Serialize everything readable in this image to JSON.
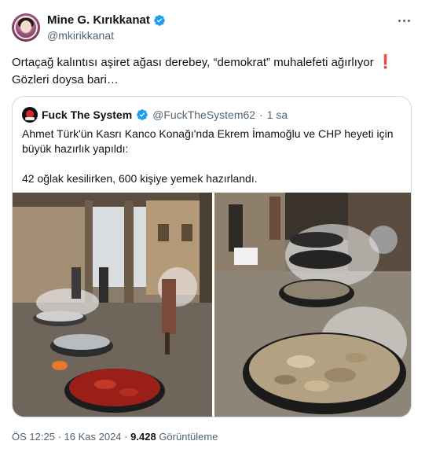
{
  "author": {
    "name": "Mine G. Kırıkkanat",
    "handle": "@mkirikkanat",
    "verified_icon": "verified-badge-icon",
    "avatar_icon": "profile-avatar"
  },
  "tweet": {
    "text_line1": "Ortaçağ kalıntısı aşiret ağası derebey, “demokrat” muhalefeti ağırlıyor",
    "exclamation": "❗",
    "text_line2": "Gözleri doysa bari…"
  },
  "quote": {
    "name": "Fuck The System",
    "handle": "@FuckTheSystem62",
    "separator": "·",
    "time": "1 sa",
    "para1": "Ahmet Türk'ün Kasrı Kanco Konağı'nda Ekrem İmamoğlu ve CHP heyeti için büyük hazırlık yapıldı:",
    "para2": "42 oğlak kesilirken, 600 kişiye yemek hazırlandı."
  },
  "meta": {
    "time": "ÖS 12:25",
    "separator": "·",
    "date": "16 Kas 2024",
    "views_count": "9.428",
    "views_label": "Görüntüleme"
  },
  "colors": {
    "text": "#0f1419",
    "secondary": "#536471",
    "verified": "#1d9bf0",
    "border": "#cfd9de",
    "exclamation": "#d21f3c"
  }
}
